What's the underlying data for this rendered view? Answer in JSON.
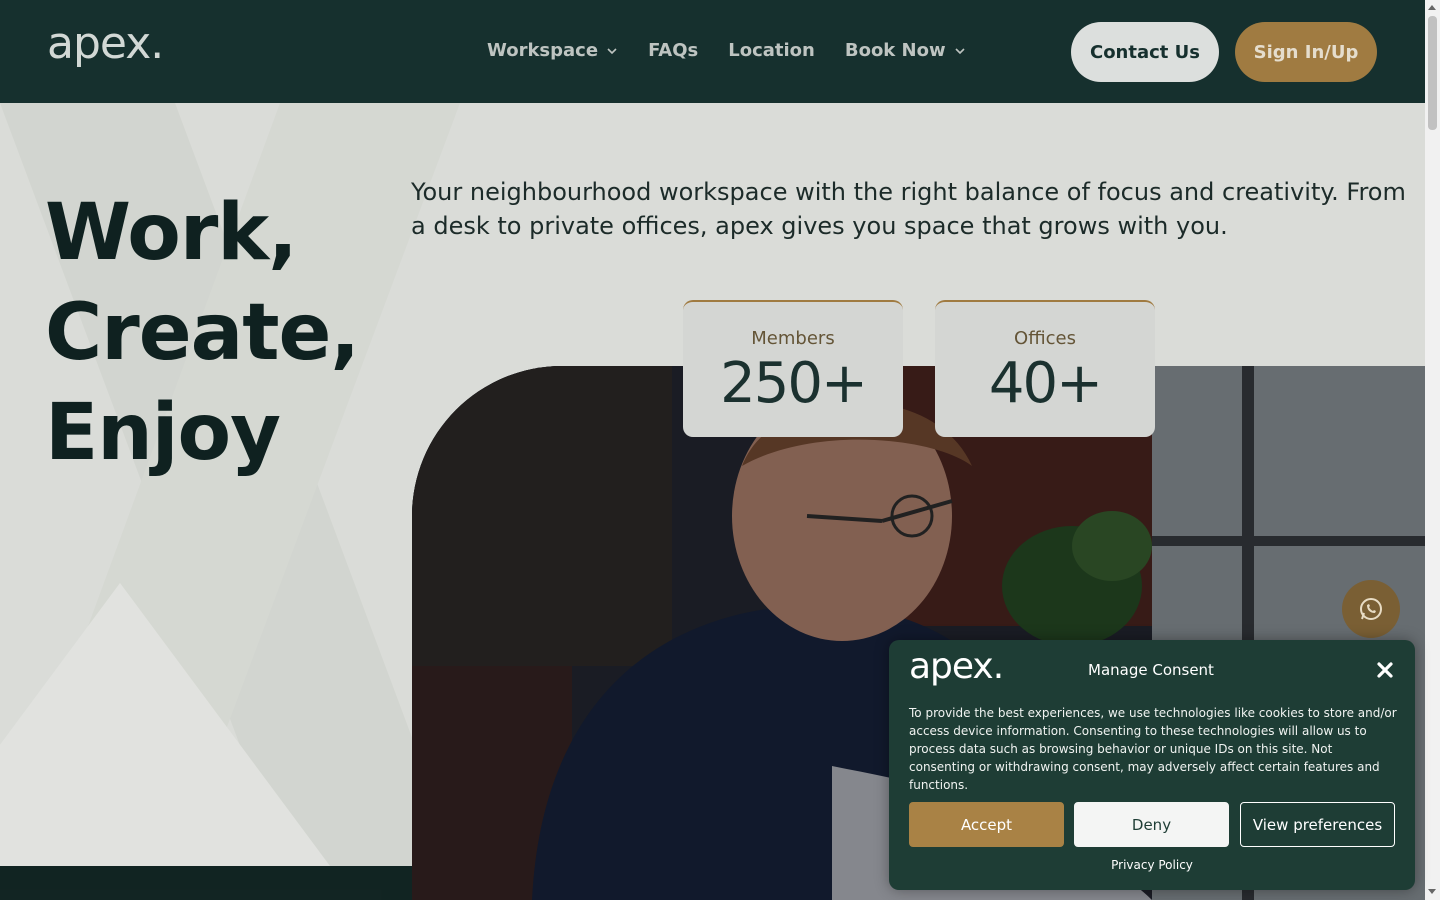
{
  "brand": {
    "logo_text": "apex."
  },
  "header": {
    "nav": [
      {
        "label": "Workspace",
        "has_dropdown": true
      },
      {
        "label": "FAQs",
        "has_dropdown": false
      },
      {
        "label": "Location",
        "has_dropdown": false
      },
      {
        "label": "Book Now",
        "has_dropdown": true
      }
    ],
    "contact_label": "Contact Us",
    "signin_label": "Sign In/Up"
  },
  "hero": {
    "title_lines": [
      "Work,",
      "Create,",
      "Enjoy"
    ],
    "description": "Your neighbourhood workspace with the right balance of focus and creativity. From a desk to private offices, apex gives you space that grows with you.",
    "stats": [
      {
        "label": "Members",
        "value": "250+"
      },
      {
        "label": "Offices",
        "value": "40+"
      }
    ]
  },
  "consent": {
    "logo_text": "apex.",
    "title": "Manage Consent",
    "body": "To provide the best experiences, we use technologies like cookies to store and/or access device information. Consenting to these technologies will allow us to process data such as browsing behavior or unique IDs on this site. Not consenting or withdrawing consent, may adversely affect certain features and functions.",
    "accept_label": "Accept",
    "deny_label": "Deny",
    "preferences_label": "View preferences",
    "privacy_label": "Privacy Policy"
  },
  "colors": {
    "header_bg": "#173230",
    "accent_gold": "#a98245",
    "consent_bg": "#1e3d35",
    "hero_bg": "#e7e9e5"
  },
  "icons": {
    "dropdown": "chevron-down-icon",
    "close": "close-icon",
    "chat": "whatsapp-icon"
  }
}
